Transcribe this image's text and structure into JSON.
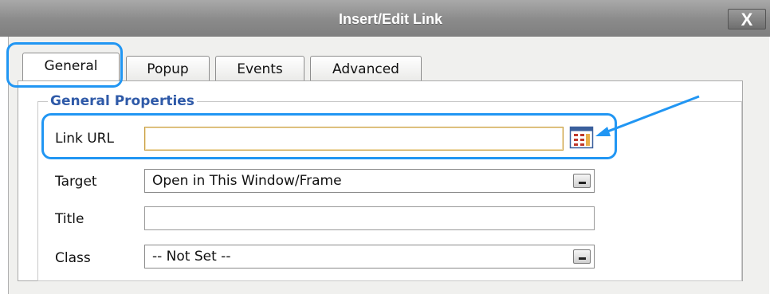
{
  "dialog": {
    "title": "Insert/Edit Link",
    "close_label": "X"
  },
  "tabs": [
    {
      "label": "General",
      "active": true
    },
    {
      "label": "Popup",
      "active": false
    },
    {
      "label": "Events",
      "active": false
    },
    {
      "label": "Advanced",
      "active": false
    }
  ],
  "general": {
    "legend": "General Properties",
    "link_url": {
      "label": "Link URL",
      "value": ""
    },
    "target": {
      "label": "Target",
      "value": "Open in This Window/Frame"
    },
    "title": {
      "label": "Title",
      "value": ""
    },
    "class": {
      "label": "Class",
      "value": "-- Not Set --"
    }
  },
  "icons": {
    "close": "close-icon",
    "browse": "browse-icon",
    "dropdown": "dropdown-arrow-icon"
  },
  "colors": {
    "titlebar": "#8f8f8f",
    "legend": "#2f5aa8",
    "annotation": "#2196f3",
    "url_border": "#c79c3e"
  }
}
